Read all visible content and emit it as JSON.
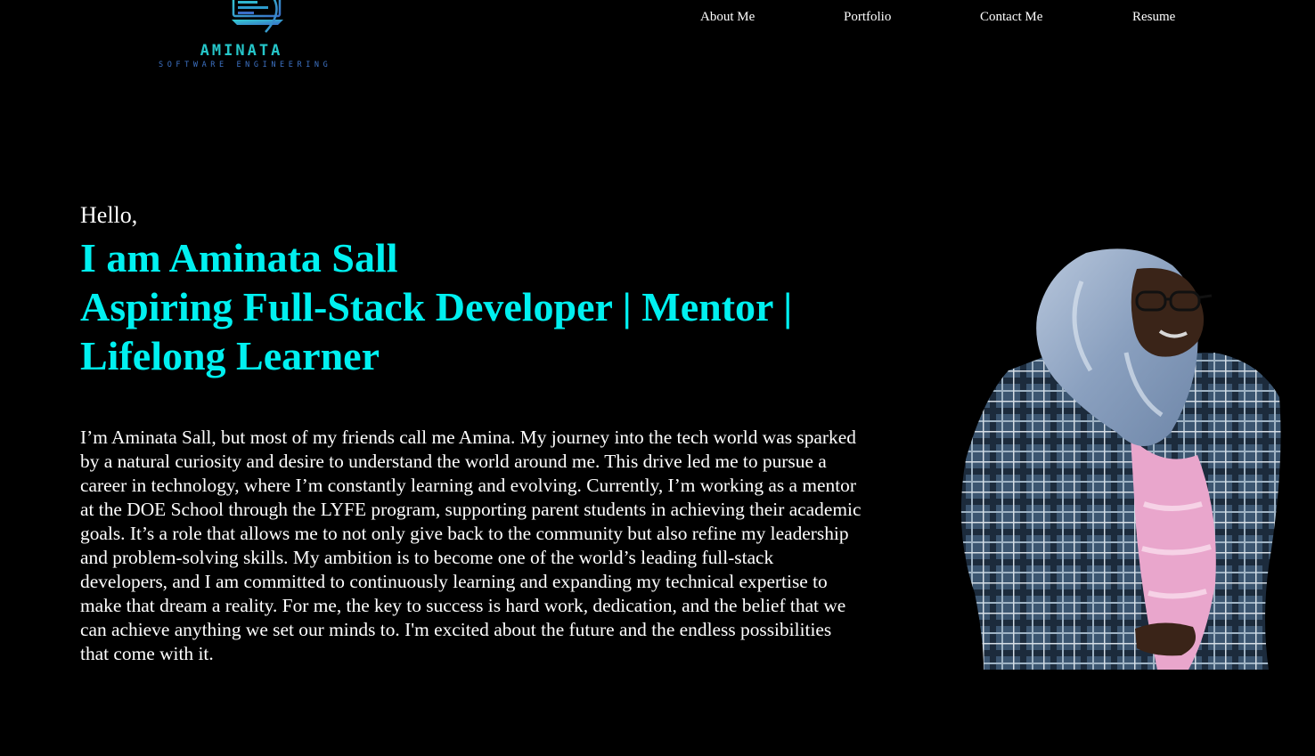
{
  "header": {
    "logo": {
      "name": "AMINATA",
      "tagline": "SOFTWARE ENGINEERING",
      "icon": "laptop-code-icon",
      "colors": {
        "name": "#25c6c9",
        "tagline": "#3d72c4"
      }
    },
    "nav": [
      {
        "label": "About Me"
      },
      {
        "label": "Portfolio"
      },
      {
        "label": "Contact Me"
      },
      {
        "label": "Resume"
      }
    ]
  },
  "hero": {
    "greeting": "Hello,",
    "name_line": "I am Aminata Sall",
    "title_line_1": "Aspiring Full-Stack Developer | Mentor |",
    "title_line_2": "Lifelong Learner",
    "bio": "I’m Aminata Sall, but most of my friends call me Amina. My journey into the tech world was sparked by a natural curiosity and desire to understand the world around me. This drive led me to pursue a career in technology, where I’m constantly learning and evolving. Currently, I’m working as a mentor at the DOE School through the LYFE program, supporting parent students in achieving their academic goals. It’s a role that allows me to not only give back to the community but also refine my leadership and problem-solving skills. My ambition is to become one of the world’s leading full-stack developers, and I am committed to continuously learning and expanding my technical expertise to make that dream a reality. For me, the key to success is hard work, dedication, and the belief that we can achieve anything we set our minds to. I'm excited about the future and the endless possibilities that come with it."
  },
  "colors": {
    "background": "#000000",
    "accent": "#00f0f0",
    "text": "#ffffff"
  }
}
